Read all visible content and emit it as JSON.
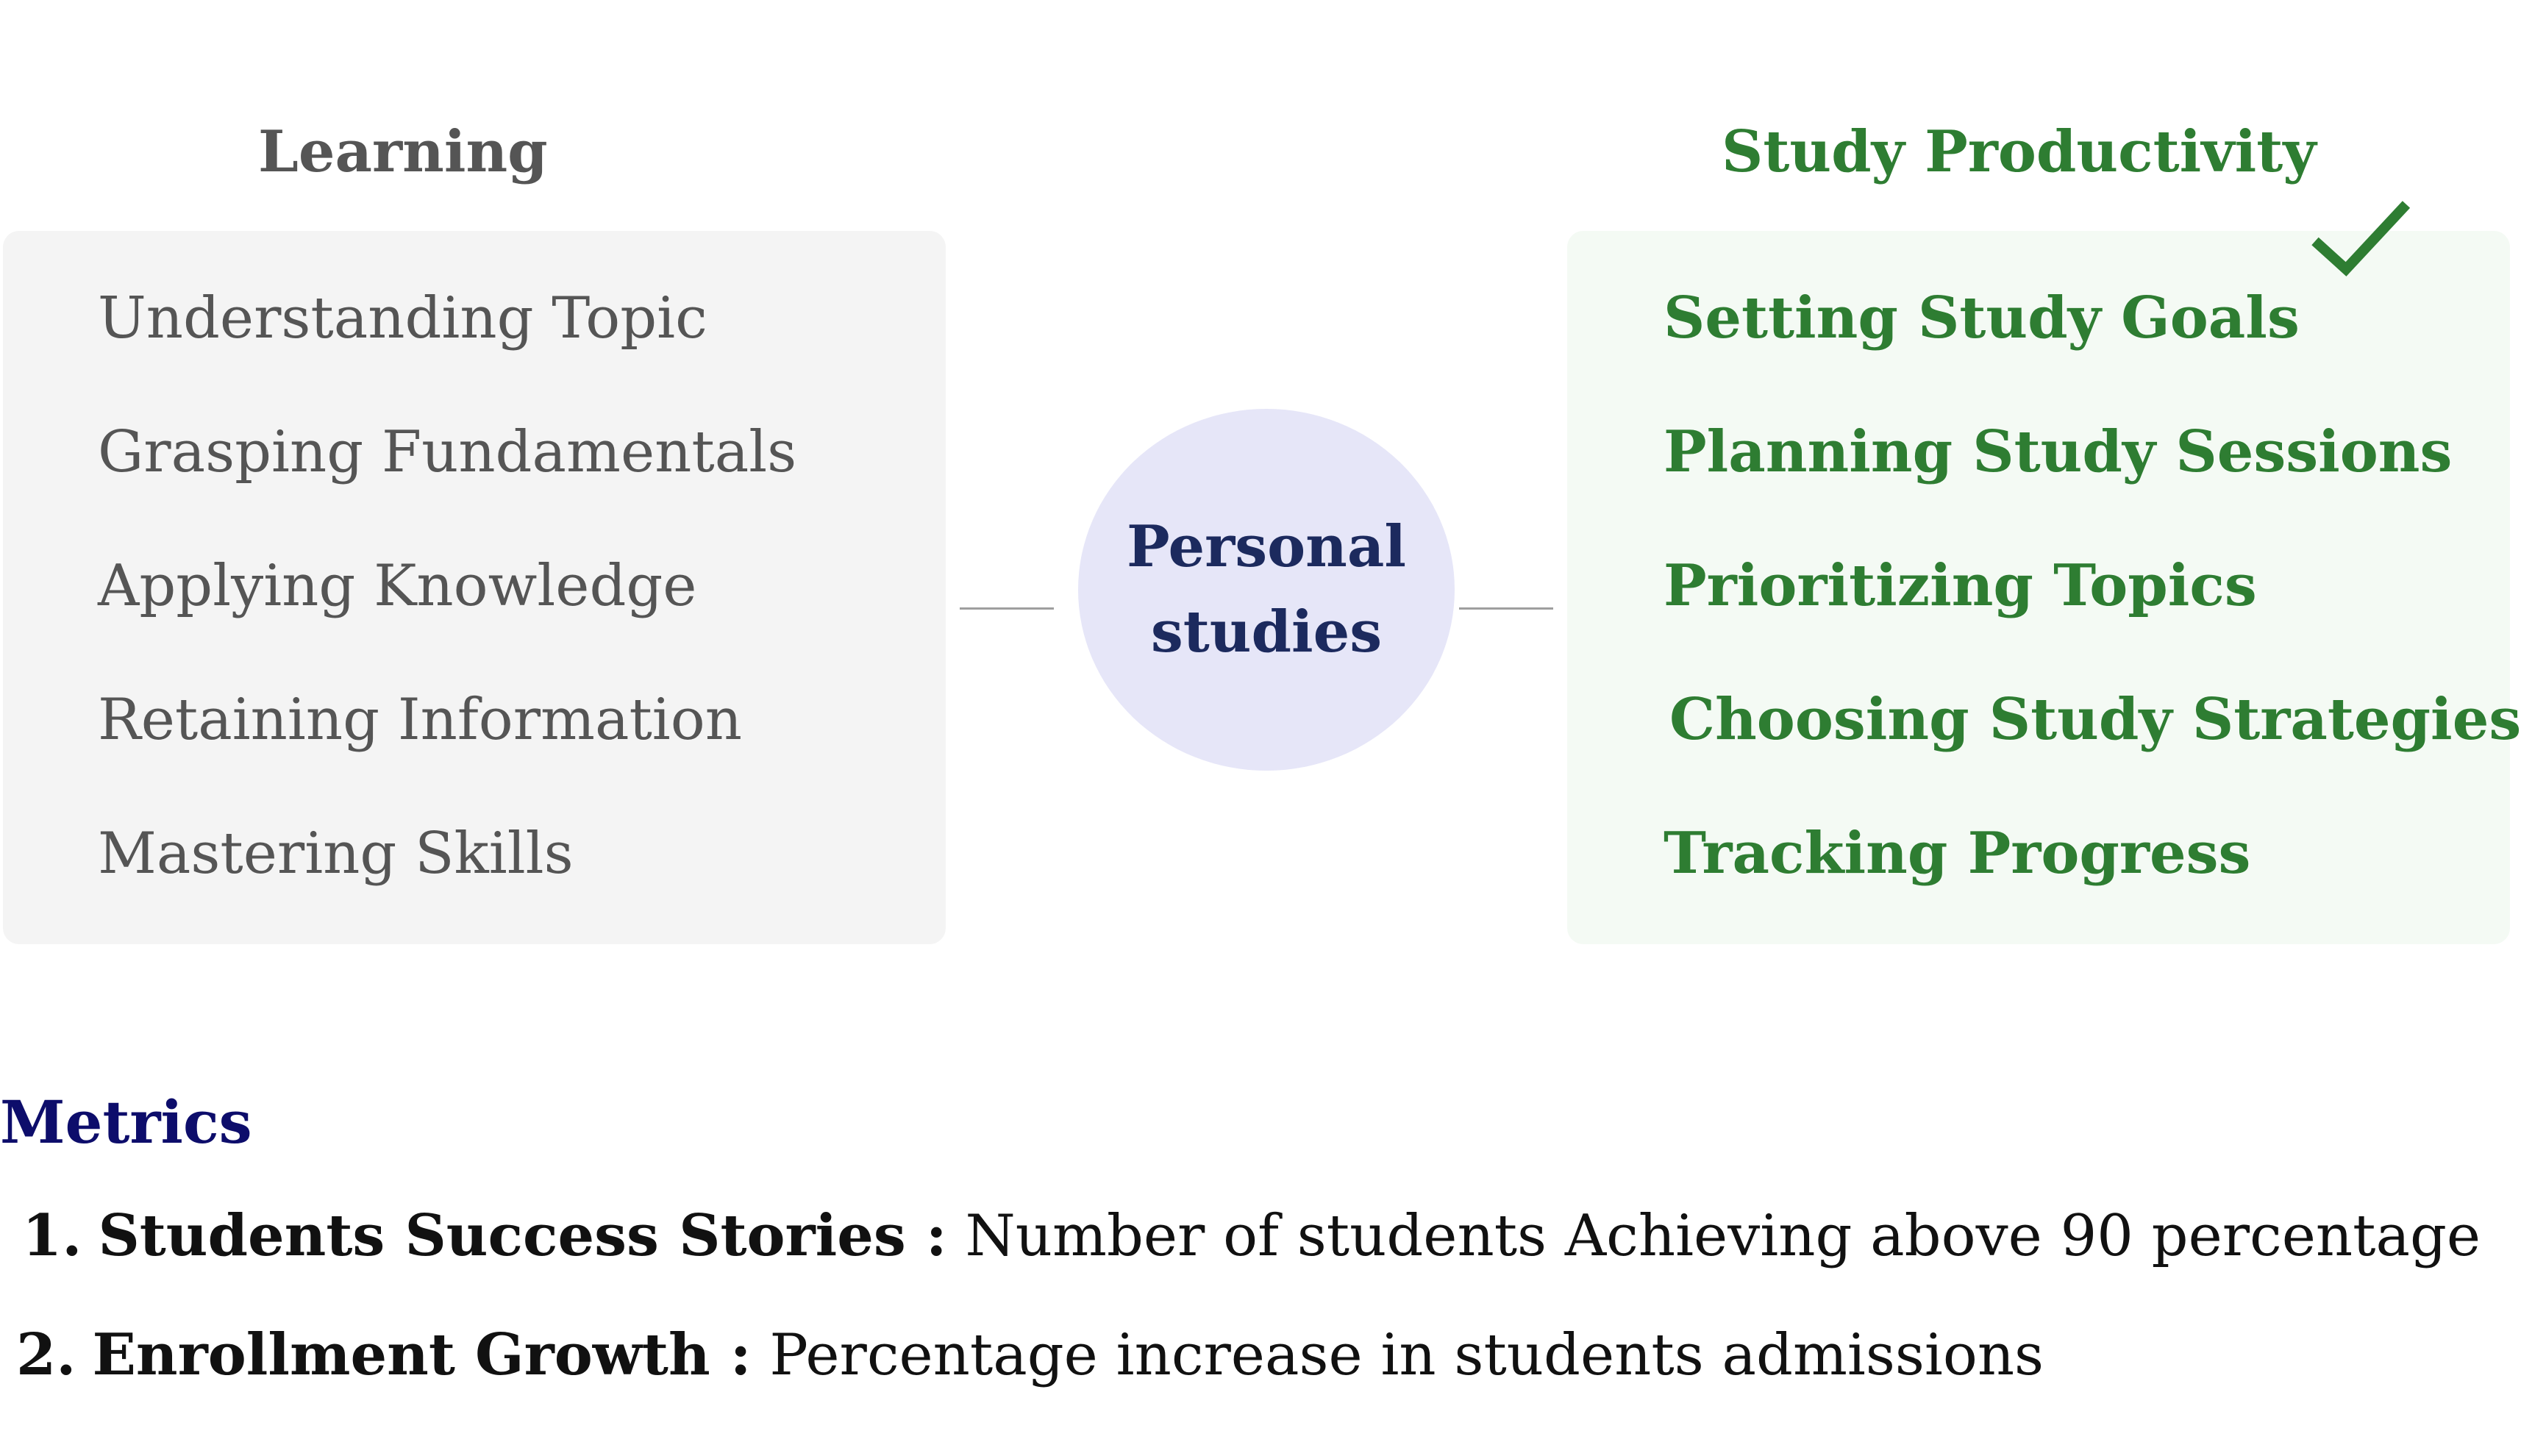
{
  "learning": {
    "heading": "Learning",
    "items": [
      "Understanding Topic",
      "Grasping Fundamentals",
      "Applying Knowledge",
      "Retaining Information",
      "Mastering Skills"
    ]
  },
  "center": {
    "line1": "Personal",
    "line2": "studies"
  },
  "productivity": {
    "heading": "Study Productivity",
    "check_icon": "checkmark-icon",
    "items": [
      "Setting Study Goals",
      "Planning Study Sessions",
      "Prioritizing Topics",
      "Choosing Study Strategies",
      "Tracking Progress"
    ]
  },
  "metrics": {
    "title": "Metrics",
    "items": [
      {
        "number": "1.",
        "label": "Students Success Stories :",
        "description": " Number of students Achieving above 90 percentage"
      },
      {
        "number": "2.",
        "label": "Enrollment Growth :",
        "description": " Percentage increase in students admissions"
      }
    ]
  },
  "colors": {
    "learning_text": "#555555",
    "productivity_text": "#2e7d32",
    "center_fill": "#e6e6f8",
    "center_text": "#1c2a5e",
    "metrics_title": "#0d0d6b"
  }
}
